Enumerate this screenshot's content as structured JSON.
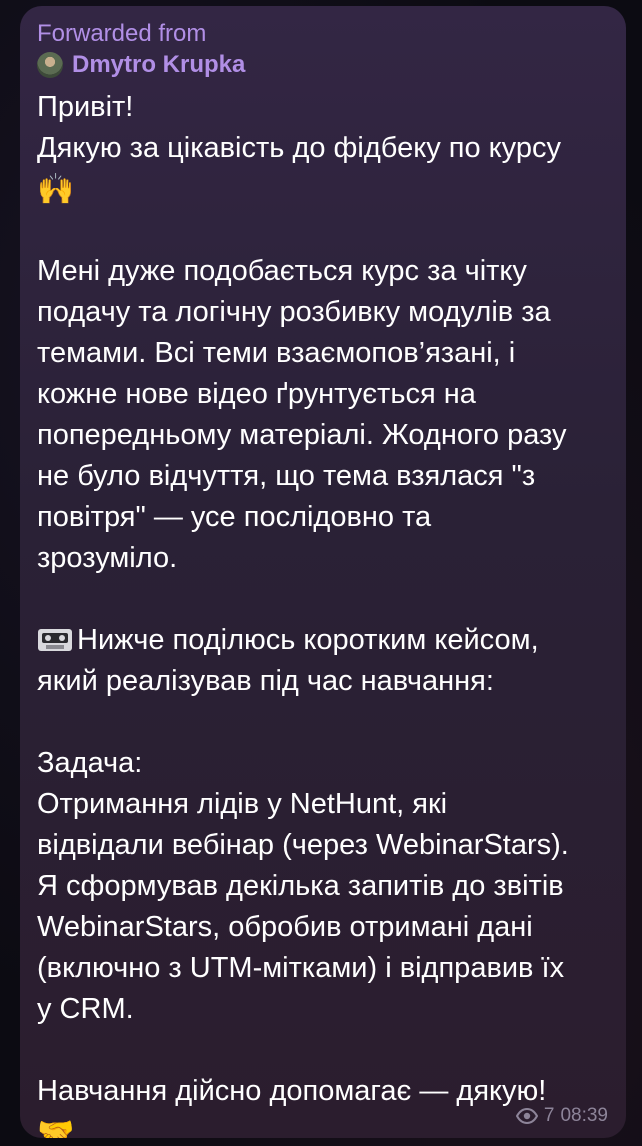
{
  "message": {
    "forward_label": "Forwarded from",
    "forward_author": "Dmytro Krupka",
    "lines": [
      "Привіт!",
      "Дякую за цікавість до фідбеку по курсу",
      "🙌",
      "",
      "Мені дуже подобається курс за чітку",
      "подачу та логічну розбивку модулів за",
      "темами. Всі теми взаємопов’язані, і",
      "кожне нове відео ґрунтується на",
      "попередньому матеріалі. Жодного разу",
      "не було відчуття, що тема взялася \"з",
      "повітря\" — усе послідовно та",
      "зрозуміло.",
      "",
      "Нижче поділюсь коротким кейсом,",
      "який реалізував під час навчання:",
      "",
      "Задача:",
      "Отримання лідів у NetHunt, які",
      "відвідали вебінар (через WebinarStars).",
      "Я сформував декілька запитів до звітів",
      "WebinarStars, обробив отримані дані",
      "(включно з UTM-мітками) і відправив їх",
      "у CRM.",
      "",
      "Навчання дійсно допомагає — дякую!",
      "🤝"
    ],
    "views": "7",
    "time": "08:39"
  },
  "icons": {
    "avatar": "avatar",
    "videocassette": "videocassette-icon",
    "views": "eye-icon"
  },
  "colors": {
    "forward_accent": "#b18fe6",
    "text": "#ffffff",
    "meta": "#8d8499"
  }
}
